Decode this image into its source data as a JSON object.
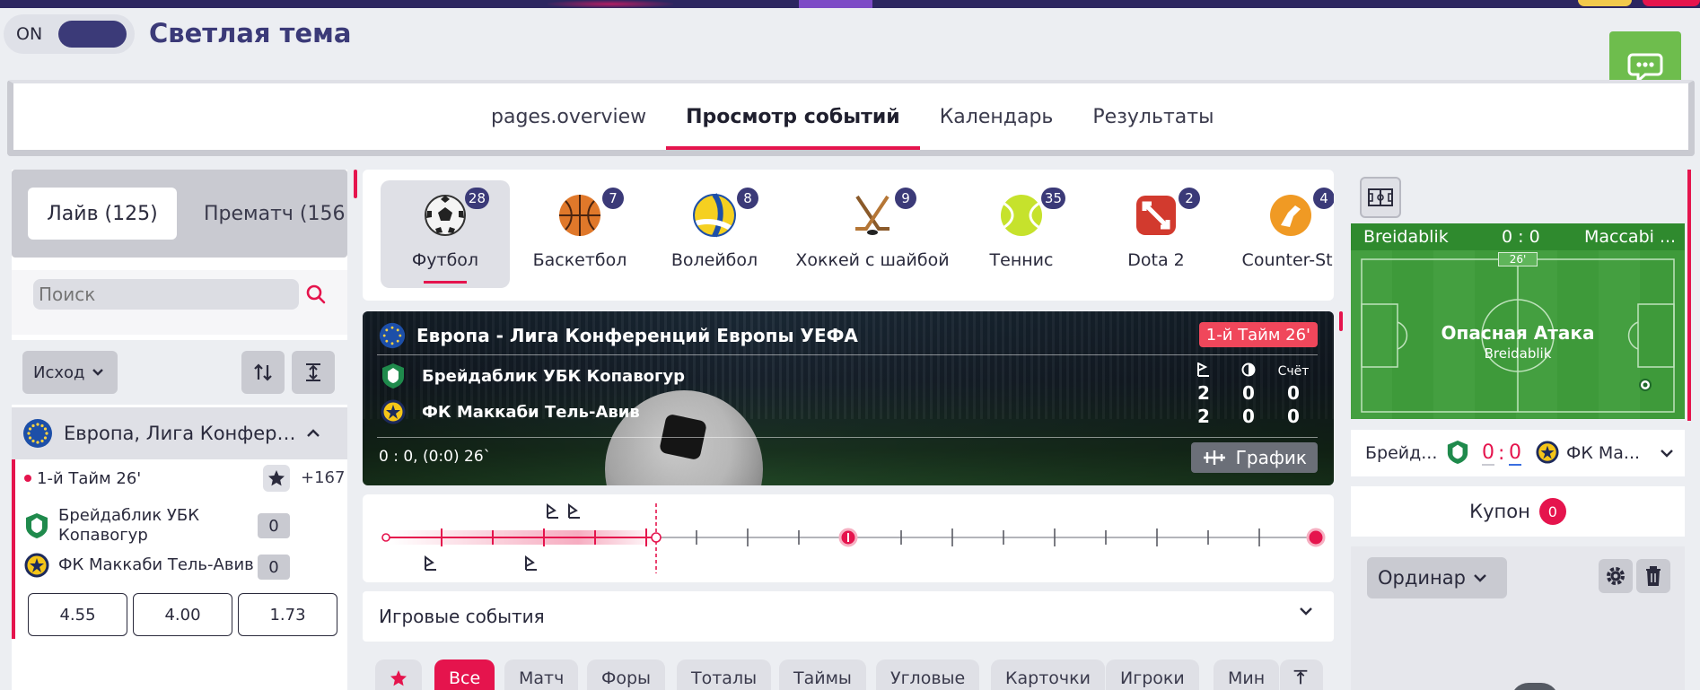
{
  "theme": {
    "toggle_state": "ON",
    "title": "Светлая тема"
  },
  "nav": {
    "tabs": [
      "pages.overview",
      "Просмотр событий",
      "Календарь",
      "Результаты"
    ],
    "active_index": 1
  },
  "left": {
    "live_label": "Лайв (125)",
    "prematch_label": "Прематч (156",
    "search_placeholder": "Поиск",
    "outcome_label": "Исход",
    "league_name": "Европа, Лига Конференций Европы УЕФА",
    "match": {
      "period": "1-й Тайм 26'",
      "more": "+167",
      "home": "Брейдаблик УБК Копавогур",
      "away": "ФК Маккаби Тель-Авив",
      "home_score": "0",
      "away_score": "0",
      "odds": [
        "4.55",
        "4.00",
        "1.73"
      ]
    }
  },
  "sports": [
    {
      "name": "Футбол",
      "count": "28",
      "icon": "soccer-ball-icon"
    },
    {
      "name": "Баскетбол",
      "count": "7",
      "icon": "basketball-icon"
    },
    {
      "name": "Волейбол",
      "count": "8",
      "icon": "volleyball-icon"
    },
    {
      "name": "Хоккей с шайбой",
      "count": "9",
      "icon": "hockey-sticks-icon"
    },
    {
      "name": "Теннис",
      "count": "35",
      "icon": "tennis-ball-icon"
    },
    {
      "name": "Dota 2",
      "count": "2",
      "icon": "dota-icon"
    },
    {
      "name": "Counter-Str",
      "count": "4",
      "icon": "counter-strike-icon"
    }
  ],
  "event": {
    "league": "Европа - Лига Конференций Европы УЕФА",
    "period": "1-й Тайм 26'",
    "home": "Брейдаблик УБК Копавогур",
    "away": "ФК Маккаби Тель-Авив",
    "stat_header": "Счёт",
    "home_stats": [
      "2",
      "0",
      "0"
    ],
    "away_stats": [
      "2",
      "0",
      "0"
    ],
    "score_line": "0 : 0, (0:0) 26`",
    "graph_label": "График"
  },
  "accordion": {
    "label": "Игровые события"
  },
  "market_tabs": [
    "Все",
    "Матч",
    "Форы",
    "Тоталы",
    "Таймы",
    "Угловые",
    "Карточки",
    "Игроки",
    "Мин"
  ],
  "pitch": {
    "home": "Breidablik",
    "score": "0 : 0",
    "away": "Maccabi ...",
    "minute": "26'",
    "state": "Опасная Атака",
    "state_team": "Breidablik"
  },
  "score_strip": {
    "home": "Брейд...",
    "home_score": "0",
    "sep": ":",
    "away_score": "0",
    "away": "ФК Ма..."
  },
  "coupon": {
    "label": "Купон",
    "count": "0",
    "type": "Ординар"
  },
  "colors": {
    "accent": "#e5144d",
    "navy": "#3b3a78",
    "pitch": "#3e9a3a",
    "chat": "#6ebd4d"
  }
}
